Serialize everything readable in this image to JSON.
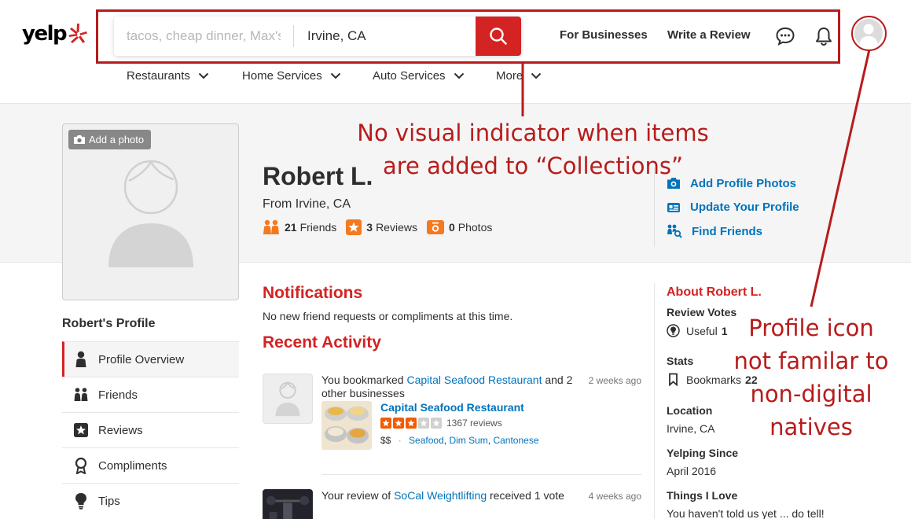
{
  "brand": {
    "logo_text": "yelp",
    "accent": "#d32323",
    "link": "#0073bb"
  },
  "search": {
    "find_placeholder": "tacos, cheap dinner, Max's",
    "near_value": "Irvine, CA",
    "button_icon": "search-icon"
  },
  "header_links": {
    "for_businesses": "For Businesses",
    "write_review": "Write a Review"
  },
  "nav": [
    {
      "label": "Restaurants"
    },
    {
      "label": "Home Services"
    },
    {
      "label": "Auto Services"
    },
    {
      "label": "More"
    }
  ],
  "profile": {
    "add_photo": "Add a photo",
    "name": "Robert L.",
    "location": "From Irvine, CA",
    "stats": [
      {
        "count": "21",
        "label": "Friends",
        "icon": "friends-icon"
      },
      {
        "count": "3",
        "label": "Reviews",
        "icon": "review-star-icon"
      },
      {
        "count": "0",
        "label": "Photos",
        "icon": "camera-icon"
      }
    ],
    "actions": [
      {
        "label": "Add Profile Photos",
        "icon": "camera-icon"
      },
      {
        "label": "Update Your Profile",
        "icon": "id-card-icon"
      },
      {
        "label": "Find Friends",
        "icon": "find-friends-icon"
      }
    ]
  },
  "sidebar": {
    "heading": "Robert's Profile",
    "items": [
      {
        "label": "Profile Overview",
        "icon": "person-icon"
      },
      {
        "label": "Friends",
        "icon": "friends-icon"
      },
      {
        "label": "Reviews",
        "icon": "star-icon"
      },
      {
        "label": "Compliments",
        "icon": "ribbon-icon"
      },
      {
        "label": "Tips",
        "icon": "lightbulb-icon"
      }
    ]
  },
  "notifications": {
    "title": "Notifications",
    "text": "No new friend requests or compliments at this time."
  },
  "recent_activity": {
    "title": "Recent Activity",
    "items": [
      {
        "prefix": "You bookmarked ",
        "link": "Capital Seafood Restaurant",
        "suffix": " and 2 other businesses",
        "time": "2 weeks ago",
        "business": {
          "name": "Capital Seafood Restaurant",
          "rating": 3,
          "reviews": "1367 reviews",
          "price": "$$",
          "categories": [
            "Seafood",
            "Dim Sum",
            "Cantonese"
          ]
        }
      },
      {
        "prefix": "Your review of ",
        "link": "SoCal Weightlifting",
        "suffix": " received 1 vote",
        "time": "4 weeks ago"
      }
    ]
  },
  "about": {
    "title": "About Robert L.",
    "review_votes_label": "Review Votes",
    "useful_label": "Useful",
    "useful_count": "1",
    "stats_label": "Stats",
    "bookmarks_label": "Bookmarks",
    "bookmarks_count": "22",
    "location_label": "Location",
    "location_value": "Irvine, CA",
    "yelping_since_label": "Yelping Since",
    "yelping_since_value": "April 2016",
    "things_label": "Things I Love",
    "things_value": "You haven't told us yet ... do tell!"
  },
  "annotations": {
    "collections_line1": "No visual indicator when items",
    "collections_line2": "are added to “Collections”",
    "profile_icon_lines": [
      "Profile icon",
      "not familar to",
      "non-digital",
      "natives"
    ],
    "color": "#b71c1c"
  }
}
